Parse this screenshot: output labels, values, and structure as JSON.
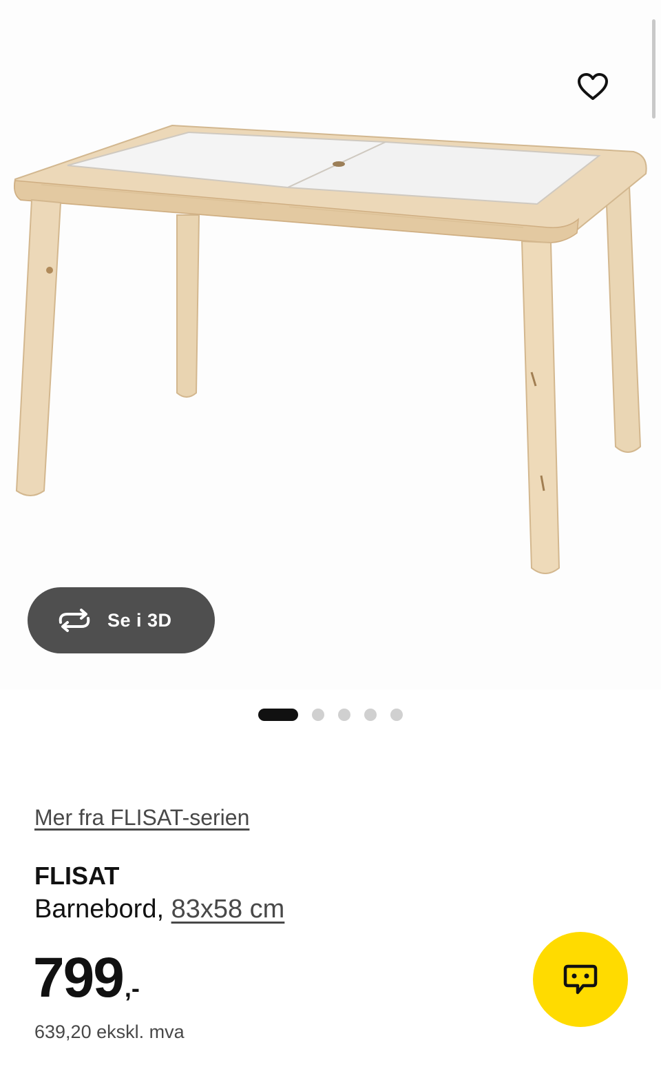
{
  "gallery": {
    "image_alt": "FLISAT Barnebord",
    "view_3d_label": "Se i 3D",
    "slide_count": 5,
    "active_slide": 1
  },
  "product": {
    "series_link": "Mer fra FLISAT-serien",
    "name": "FLISAT",
    "description": "Barnebord,",
    "size": "83x58 cm",
    "price": "799",
    "price_suffix": ",-",
    "price_ex_vat": "639,20 ekskl. mva"
  },
  "icons": {
    "favorite": "heart-icon",
    "view_3d": "rotate-icon",
    "chat": "chat-icon"
  },
  "colors": {
    "chat_button": "#ffdb00",
    "view_3d_button": "#4f4f4f",
    "wood": "#ecd8b8",
    "table_top": "#f4f4f4"
  }
}
